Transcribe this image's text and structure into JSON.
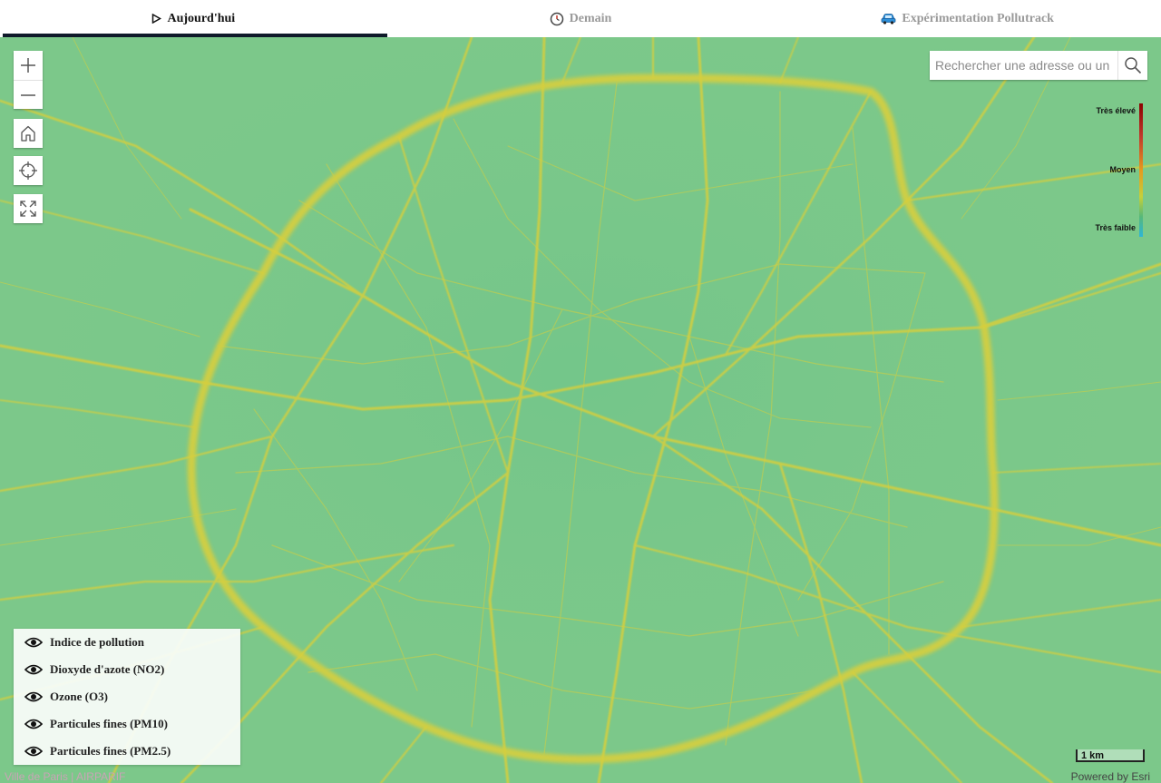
{
  "tabs": [
    {
      "label": "Aujourd'hui",
      "icon": "play-outline-icon",
      "active": true
    },
    {
      "label": "Demain",
      "icon": "clock-icon",
      "active": false
    },
    {
      "label": "Expérimentation Pollutrack",
      "icon": "car-icon",
      "active": false
    }
  ],
  "map": {
    "background_color": "#7cc88a",
    "road_color": "#d4cf3a",
    "controls": [
      "zoom-in",
      "zoom-out",
      "home",
      "locate",
      "fullscreen"
    ]
  },
  "search": {
    "placeholder": "Rechercher une adresse ou un"
  },
  "legend": {
    "high": "Très élevé",
    "mid": "Moyen",
    "low": "Très faible",
    "colors": [
      "#8b0000",
      "#c0392b",
      "#e59a1d",
      "#c5d03a",
      "#56b87a",
      "#2db5d8"
    ]
  },
  "layers": [
    {
      "label": "Indice de pollution"
    },
    {
      "label": "Dioxyde d'azote (NO2)"
    },
    {
      "label": "Ozone (O3)"
    },
    {
      "label": "Particules fines (PM10)"
    },
    {
      "label": "Particules fines (PM2.5)"
    }
  ],
  "attribution": "Ville de Paris | AIRPARIF",
  "powered_by": "Powered by Esri",
  "scale": "1 km"
}
